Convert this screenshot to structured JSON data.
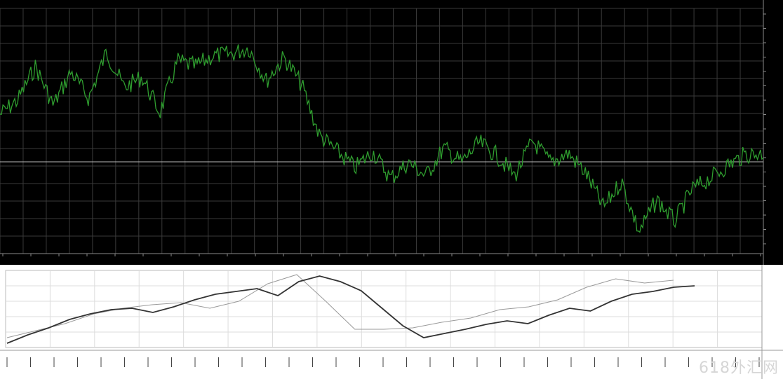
{
  "top_chart": {
    "status_text": "",
    "colors": {
      "background": "#000000",
      "grid": "#3a3a3a",
      "price_line": "#2f9e2f",
      "axis_text": "#d0d0d0",
      "hline": "#bdbdbd"
    },
    "price_labels": [
      "",
      "",
      "",
      "",
      "",
      "",
      "",
      "",
      "",
      "",
      "",
      "",
      "",
      "",
      "",
      "",
      ""
    ],
    "time_labels": [
      "",
      "",
      "",
      "",
      "",
      "",
      "",
      "",
      "",
      "",
      "",
      "",
      "",
      "",
      "",
      "",
      "",
      "",
      "",
      "",
      "",
      "",
      "",
      "",
      "",
      "",
      "",
      ""
    ],
    "price_series": [
      -0.35,
      -0.08,
      0.55,
      -0.18,
      0.45,
      -0.05,
      0.82,
      0.15,
      0.35,
      -0.32,
      0.65,
      0.55,
      0.75,
      0.78,
      0.9,
      0.28,
      0.72,
      0.2,
      -0.75,
      -1.05,
      -1.35,
      -1.05,
      -1.55,
      -1.25,
      -1.5,
      -0.98,
      -1.25,
      -0.88,
      -1.12,
      -1.5,
      -0.85,
      -1.25,
      -1.08,
      -1.45,
      -2.1,
      -1.6,
      -2.55,
      -1.95,
      -2.35,
      -1.75,
      -1.55,
      -1.3,
      -1.1,
      -1.08
    ]
  },
  "bottom_panel": {
    "header_text": "",
    "watermark": "618外汇网",
    "colors": {
      "background": "#ffffff",
      "grid": "#dcdcdc",
      "line": "#333333",
      "thin_line": "#9a9a9a"
    },
    "axis_labels": [
      "",
      "",
      "",
      "",
      "",
      "",
      "",
      "",
      "",
      "",
      "",
      "",
      "",
      "",
      "",
      "",
      "",
      "",
      "",
      "",
      "",
      "",
      "",
      "",
      "",
      "",
      "",
      "",
      "",
      "",
      ""
    ],
    "main_series": [
      0,
      0.12,
      0.22,
      0.34,
      0.42,
      0.48,
      0.5,
      0.44,
      0.52,
      0.62,
      0.7,
      0.74,
      0.78,
      0.68,
      0.88,
      0.96,
      0.88,
      0.75,
      0.5,
      0.25,
      0.08,
      0.14,
      0.2,
      0.27,
      0.32,
      0.28,
      0.4,
      0.5,
      0.46,
      0.6,
      0.7,
      0.74,
      0.8,
      0.82
    ],
    "thin_series": [
      0.08,
      0.18,
      0.28,
      0.42,
      0.5,
      0.55,
      0.58,
      0.5,
      0.6,
      0.85,
      0.98,
      0.6,
      0.2,
      0.2,
      0.22,
      0.3,
      0.36,
      0.48,
      0.52,
      0.62,
      0.8,
      0.92,
      0.86,
      0.9
    ]
  }
}
